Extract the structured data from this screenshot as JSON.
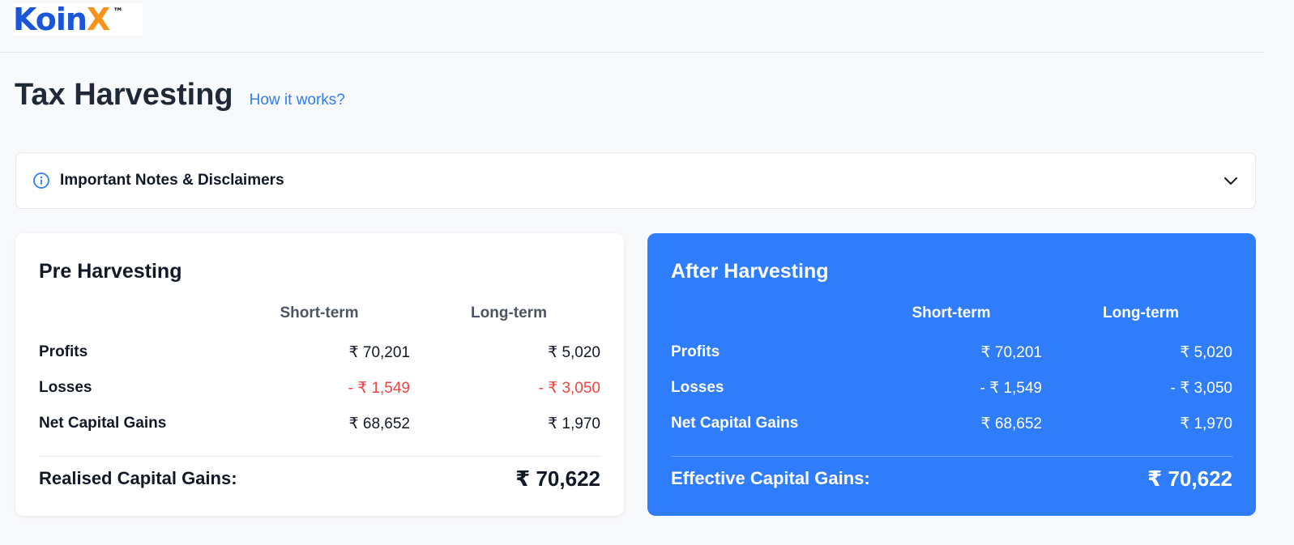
{
  "brand": {
    "name_main": "Koin",
    "name_accent": "X",
    "tm": "™"
  },
  "header": {
    "title": "Tax Harvesting",
    "link": "How it works?"
  },
  "notes": {
    "label": "Important Notes & Disclaimers"
  },
  "pre": {
    "title": "Pre Harvesting",
    "col_short": "Short-term",
    "col_long": "Long-term",
    "rows": [
      {
        "label": "Profits",
        "short": "₹ 70,201",
        "long": "₹ 5,020"
      },
      {
        "label": "Losses",
        "short": "- ₹ 1,549",
        "long": "- ₹ 3,050"
      },
      {
        "label": "Net Capital Gains",
        "short": "₹ 68,652",
        "long": "₹ 1,970"
      }
    ],
    "total_label": "Realised Capital Gains:",
    "total_value": "₹ 70,622"
  },
  "post": {
    "title": "After Harvesting",
    "col_short": "Short-term",
    "col_long": "Long-term",
    "rows": [
      {
        "label": "Profits",
        "short": "₹ 70,201",
        "long": "₹ 5,020"
      },
      {
        "label": "Losses",
        "short": "- ₹ 1,549",
        "long": "- ₹ 3,050"
      },
      {
        "label": "Net Capital Gains",
        "short": "₹ 68,652",
        "long": "₹ 1,970"
      }
    ],
    "total_label": "Effective Capital Gains:",
    "total_value": "₹ 70,622"
  },
  "colors": {
    "brand_blue": "#1a56db",
    "brand_orange": "#f7931a",
    "link_blue": "#2f7ef5",
    "after_card_bg": "#2f7dfa",
    "loss_red": "#ef4444"
  },
  "icons": {
    "info": "info-icon",
    "expand": "chevron-down-icon"
  }
}
